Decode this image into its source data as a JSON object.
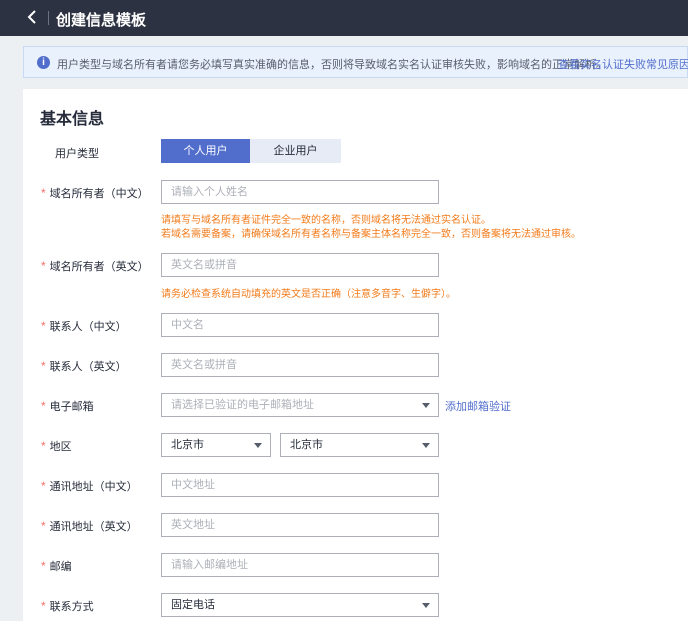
{
  "header": {
    "title": "创建信息模板"
  },
  "notice": {
    "text": "用户类型与域名所有者请您务必填写真实准确的信息，否则将导致域名实名认证审核失败，影响域名的正常解析。",
    "link": "查看实名认证失败常见原因"
  },
  "form": {
    "section_title": "基本信息",
    "user_type": {
      "label": "用户类型",
      "options": [
        "个人用户",
        "企业用户"
      ],
      "selected": "个人用户"
    },
    "owner_cn": {
      "label": "域名所有者（中文）",
      "placeholder": "请输入个人姓名",
      "hint1": "请填写与域名所有者证件完全一致的名称，否则域名将无法通过实名认证。",
      "hint2": "若域名需要备案，请确保域名所有者名称与备案主体名称完全一致，否则备案将无法通过审核。"
    },
    "owner_en": {
      "label": "域名所有者（英文）",
      "placeholder": "英文名或拼音",
      "hint": "请务必检查系统自动填充的英文是否正确（注意多音字、生僻字）。"
    },
    "contact_cn": {
      "label": "联系人（中文）",
      "placeholder": "中文名"
    },
    "contact_en": {
      "label": "联系人（英文）",
      "placeholder": "英文名或拼音"
    },
    "email": {
      "label": "电子邮箱",
      "placeholder": "请选择已验证的电子邮箱地址",
      "add_link": "添加邮箱验证"
    },
    "region": {
      "label": "地区",
      "province": "北京市",
      "city": "北京市"
    },
    "address_cn": {
      "label": "通讯地址（中文）",
      "placeholder": "中文地址"
    },
    "address_en": {
      "label": "通讯地址（英文）",
      "placeholder": "英文地址"
    },
    "postcode": {
      "label": "邮编",
      "placeholder": "请输入邮编地址"
    },
    "contact_method": {
      "label": "联系方式",
      "value": "固定电话"
    }
  },
  "colors": {
    "primary": "#526ecc",
    "required": "#f66f6a",
    "hint": "#f27b1a",
    "topbar": "#2c3241"
  }
}
